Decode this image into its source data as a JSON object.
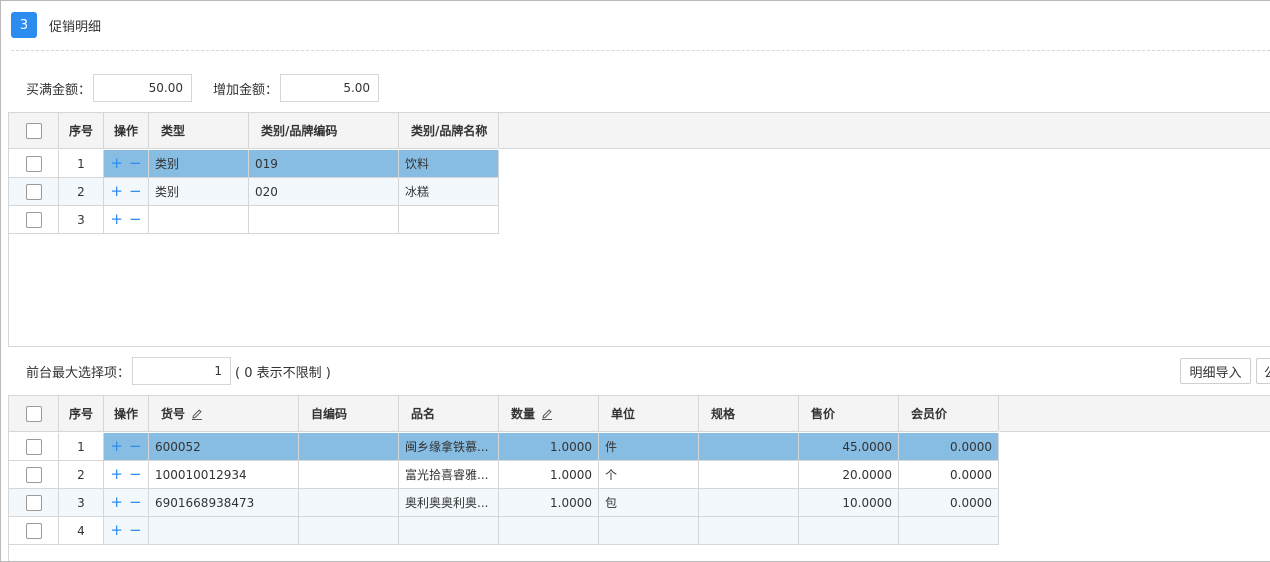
{
  "section": {
    "step": "3",
    "title": "促销明细"
  },
  "amounts": {
    "buy_full_label": "买满金额：",
    "buy_full_value": "50.00",
    "add_label": "增加金额：",
    "add_value": "5.00"
  },
  "grid1": {
    "headers": {
      "no": "序号",
      "op": "操作",
      "type": "类型",
      "code": "类别/品牌编码",
      "name": "类别/品牌名称"
    },
    "rows": [
      {
        "no": "1",
        "type": "类别",
        "code": "019",
        "name": "饮料"
      },
      {
        "no": "2",
        "type": "类别",
        "code": "020",
        "name": "冰糕"
      },
      {
        "no": "3",
        "type": "",
        "code": "",
        "name": ""
      }
    ]
  },
  "max_select": {
    "label": "前台最大选择项：",
    "value": "1",
    "hint": "( 0 表示不限制 )"
  },
  "toolbar": {
    "import_label": "明细导入",
    "next_label": "公"
  },
  "grid2": {
    "headers": {
      "no": "序号",
      "op": "操作",
      "sku": "货号",
      "selfcode": "自编码",
      "name": "品名",
      "qty": "数量",
      "unit": "单位",
      "spec": "规格",
      "price": "售价",
      "member": "会员价"
    },
    "rows": [
      {
        "no": "1",
        "sku": "600052",
        "selfcode": "",
        "name": "闽乡缘拿铁慕...",
        "qty": "1.0000",
        "unit": "件",
        "spec": "",
        "price": "45.0000",
        "member": "0.0000"
      },
      {
        "no": "2",
        "sku": "100010012934",
        "selfcode": "",
        "name": "富光拾喜睿雅...",
        "qty": "1.0000",
        "unit": "个",
        "spec": "",
        "price": "20.0000",
        "member": "0.0000"
      },
      {
        "no": "3",
        "sku": "6901668938473",
        "selfcode": "",
        "name": "奥利奥奥利奥...",
        "qty": "1.0000",
        "unit": "包",
        "spec": "",
        "price": "10.0000",
        "member": "0.0000"
      },
      {
        "no": "4",
        "sku": "",
        "selfcode": "",
        "name": "",
        "qty": "",
        "unit": "",
        "spec": "",
        "price": "",
        "member": ""
      }
    ]
  },
  "icons": {
    "op_add": "+",
    "op_remove": "−",
    "edit": "pencil-icon"
  },
  "colors": {
    "accent": "#2d8cf0",
    "selected_row": "#87bde3",
    "header_bg": "#f4f4f4"
  }
}
